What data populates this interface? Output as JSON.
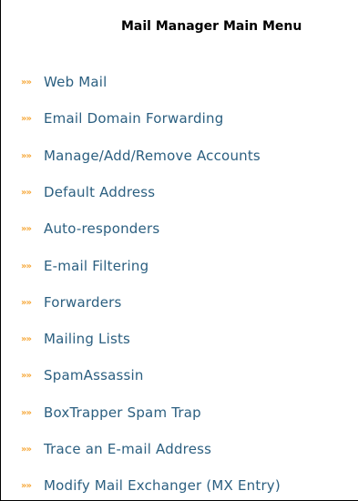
{
  "menu": {
    "title": "Mail Manager Main Menu",
    "bullet_glyph": "»»",
    "colors": {
      "bullet": "#f6a83a",
      "link": "#2b5f80",
      "title": "#000000"
    },
    "items": [
      {
        "label": "Web Mail"
      },
      {
        "label": "Email Domain Forwarding"
      },
      {
        "label": "Manage/Add/Remove Accounts"
      },
      {
        "label": "Default Address"
      },
      {
        "label": "Auto-responders"
      },
      {
        "label": "E-mail Filtering"
      },
      {
        "label": "Forwarders"
      },
      {
        "label": "Mailing Lists"
      },
      {
        "label": "SpamAssassin"
      },
      {
        "label": "BoxTrapper Spam Trap"
      },
      {
        "label": "Trace an E-mail Address"
      },
      {
        "label": "Modify Mail Exchanger (MX Entry)"
      }
    ]
  }
}
